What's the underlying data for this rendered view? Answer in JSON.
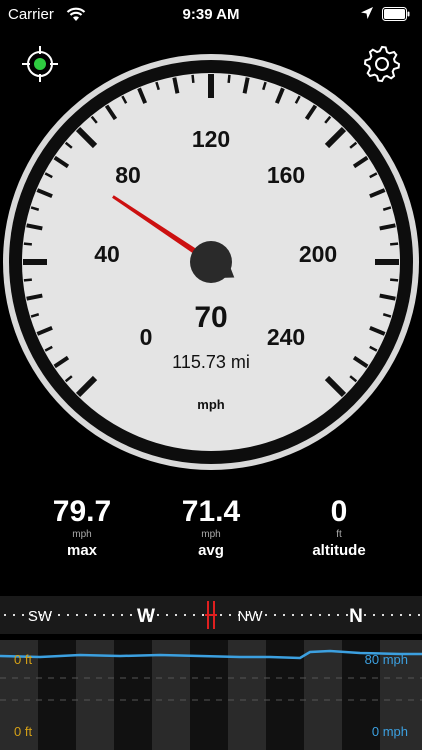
{
  "status_bar": {
    "carrier": "Carrier",
    "time": "9:39 AM"
  },
  "gauge": {
    "scale_labels": [
      "0",
      "40",
      "80",
      "120",
      "160",
      "200",
      "240"
    ],
    "scale_max": 240,
    "current_speed": "70",
    "needle_value": 70,
    "distance": "115.73 mi",
    "unit": "mph",
    "colors": {
      "face": "#e4e4e4",
      "rim": "#111111",
      "needle": "#cc1010",
      "hub": "#2a2a2a"
    }
  },
  "stats": {
    "max": {
      "value": "79.7",
      "unit": "mph",
      "label": "max"
    },
    "avg": {
      "value": "71.4",
      "unit": "mph",
      "label": "avg"
    },
    "altitude": {
      "value": "0",
      "unit": "ft",
      "label": "altitude"
    }
  },
  "compass": {
    "labels": [
      "SW",
      "W",
      "NW",
      "N"
    ],
    "indicator_color": "#e02020"
  },
  "graph": {
    "left_top": "0 ft",
    "left_bottom": "0 ft",
    "right_top": "80 mph",
    "right_bottom": "0 mph",
    "line_color": "#3ca0e0"
  },
  "icons": {
    "gps": "gps-crosshair-icon",
    "settings": "gear-icon",
    "wifi": "wifi-icon",
    "location": "location-arrow-icon",
    "battery": "battery-icon"
  }
}
